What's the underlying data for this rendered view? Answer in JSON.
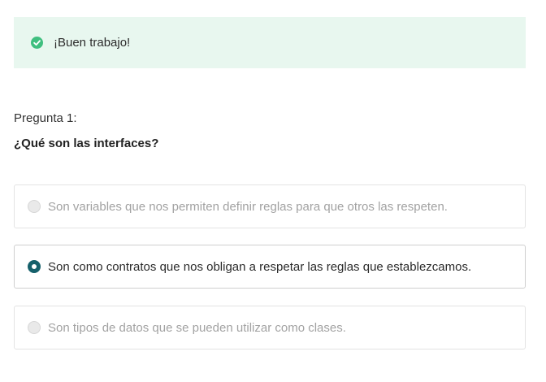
{
  "feedback": {
    "icon": "check-circle-icon",
    "color": "#3fbf7f",
    "background": "#e8f7ef",
    "message": "¡Buen trabajo!"
  },
  "question": {
    "label": "Pregunta 1:",
    "text": "¿Qué son las interfaces?"
  },
  "options": [
    {
      "text": "Son variables que nos permiten definir reglas para que otros las respeten.",
      "selected": false
    },
    {
      "text": "Son como contratos que nos obligan a respetar las reglas que establezcamos.",
      "selected": true
    },
    {
      "text": "Son tipos de datos que se pueden utilizar como clases.",
      "selected": false
    }
  ],
  "colors": {
    "radio_selected": "#15606b"
  }
}
